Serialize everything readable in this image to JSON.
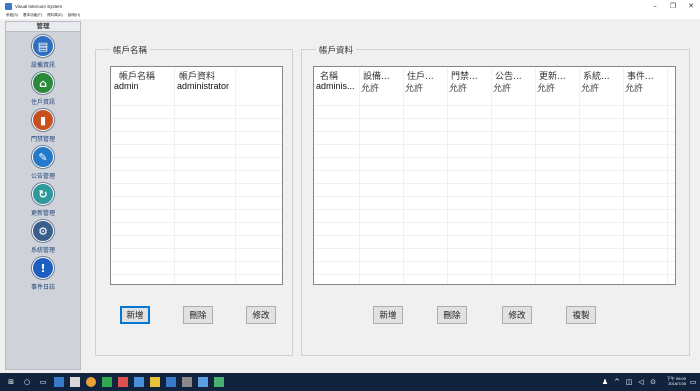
{
  "window": {
    "title": "Visual Intercom System",
    "controls": {
      "minimize": "–",
      "maximize": "❐",
      "close": "✕"
    }
  },
  "menu": [
    {
      "label": "系統(S)"
    },
    {
      "label": "基本功能(F)"
    },
    {
      "label": "資料庫(D)"
    },
    {
      "label": "說明(H)"
    }
  ],
  "sidebar": {
    "header": "管理",
    "items": [
      {
        "label": "設備資訊",
        "icon": "device-icon",
        "color": "#2f6fc0"
      },
      {
        "label": "住戶資訊",
        "icon": "resident-icon",
        "color": "#2a8a3a"
      },
      {
        "label": "門禁管理",
        "icon": "door-icon",
        "color": "#c8501f"
      },
      {
        "label": "公告管理",
        "icon": "notice-icon",
        "color": "#2579c9"
      },
      {
        "label": "更新管理",
        "icon": "update-icon",
        "color": "#2f9a9a"
      },
      {
        "label": "系統管理",
        "icon": "system-gear-icon",
        "color": "#3a5f8a"
      },
      {
        "label": "事件日誌",
        "icon": "event-log-icon",
        "color": "#1f5fbf"
      }
    ]
  },
  "accounts_panel": {
    "title": "帳戶名稱",
    "columns": [
      "帳戶名稱",
      "帳戶資料"
    ],
    "rows": [
      {
        "name": "admin",
        "info": "administrator"
      }
    ],
    "buttons": {
      "add": "新增",
      "delete": "刪除",
      "edit": "修改"
    }
  },
  "account_data_panel": {
    "title": "帳戶資料",
    "columns": [
      "名稱",
      "設備...",
      "住戶...",
      "門禁...",
      "公告...",
      "更新...",
      "系統...",
      "事件..."
    ],
    "rows": [
      {
        "cells": [
          "adminis...",
          "允許",
          "允許",
          "允許",
          "允許",
          "允許",
          "允許",
          "允許"
        ]
      }
    ],
    "buttons": {
      "add": "新增",
      "delete": "刪除",
      "edit": "修改",
      "copy": "複製"
    }
  },
  "taskbar": {
    "clock_time": "下午 06:00",
    "clock_date": "2016/7/28"
  }
}
